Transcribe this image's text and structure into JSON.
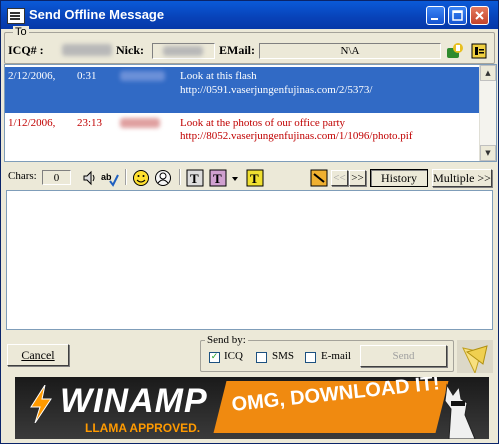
{
  "window": {
    "title": "Send Offline Message"
  },
  "to": {
    "legend": "To",
    "icq_label": "ICQ# :",
    "nick_label": "Nick:",
    "email_label": "EMail:",
    "email_value": "N\\A"
  },
  "history": {
    "messages": [
      {
        "date": "2/12/2006,",
        "time": "0:31",
        "text": "Look at  this flash",
        "url": "http://0591.vaserjungenfujinas.com/2/5373/",
        "selected": true,
        "color": "#ffffff"
      },
      {
        "date": "1/12/2006,",
        "time": "23:13",
        "text": "Look at the photos of our office party",
        "url": "http://8052.vaserjungenfujinas.com/1/1096/photo.pif",
        "selected": false,
        "color": "#c00000"
      }
    ]
  },
  "toolbar": {
    "chars_label": "Chars:",
    "chars_value": "0",
    "prev_label": "<<",
    "next_label": ">>",
    "history_label": "History",
    "multiple_label": "Multiple >>"
  },
  "footer": {
    "cancel_label": "Cancel",
    "send_by_legend": "Send by:",
    "icq_option": "ICQ",
    "icq_checked": true,
    "sms_option": "SMS",
    "email_option": "E-mail",
    "send_label": "Send"
  },
  "ad": {
    "brand": "WINAMP",
    "tagline": "LLAMA APPROVED.",
    "cta": "OMG, DOWNLOAD IT!"
  },
  "colors": {
    "selection": "#316ac5",
    "title_bar": "#0842b8",
    "unread_text": "#c00000",
    "ad_orange": "#f08a10"
  }
}
